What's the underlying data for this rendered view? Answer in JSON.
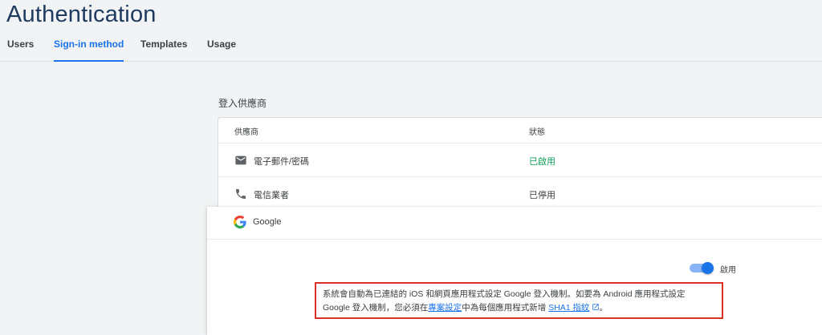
{
  "header": {
    "title": "Authentication",
    "tabs": [
      {
        "label": "Users"
      },
      {
        "label": "Sign-in method"
      },
      {
        "label": "Templates"
      },
      {
        "label": "Usage"
      }
    ]
  },
  "providers": {
    "section_title": "登入供應商",
    "col_provider": "供應商",
    "col_status": "狀態",
    "rows": [
      {
        "name": "電子郵件/密碼",
        "status": "已啟用",
        "icon": "mail-icon"
      },
      {
        "name": "電信業者",
        "status": "已停用",
        "icon": "phone-icon"
      }
    ]
  },
  "google_panel": {
    "name": "Google",
    "icon": "google-icon",
    "toggle_label": "啟用",
    "enabled": true,
    "notice": {
      "line1": "系統會自動為已連結的 iOS 和網頁應用程式設定 Google 登入機制。如要為 Android 應用程式設定",
      "line2_prefix": "Google 登入機制，您必須在",
      "link1": "專案設定",
      "line2_middle": "中為每個應用程式新增 ",
      "link2": "SHA1 指紋",
      "line2_suffix": "。"
    }
  },
  "colors": {
    "accent": "#1a73e8",
    "enabled": "#0f9d58",
    "highlight_border": "#d93025"
  }
}
